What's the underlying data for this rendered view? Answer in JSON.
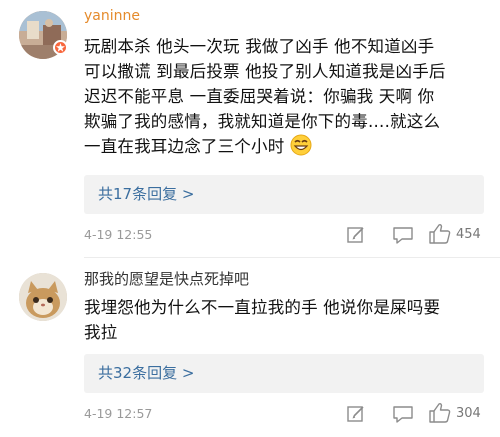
{
  "comments": [
    {
      "username": "yaninne",
      "text_lines": [
        "玩剧本杀 他头一次玩 我做了凶手 他不知道凶手",
        "可以撒谎 到最后投票 他投了别人知道我是凶手后",
        "迟迟不能平息 一直委屈哭着说：你骗我 天啊 你",
        "欺骗了我的感情，我就知道是你下的毒….就这么",
        "一直在我耳边念了三个小时"
      ],
      "emoji": "grinning-emoji",
      "reply_text": "共17条回复 >",
      "date": "4-19",
      "time": "12:55",
      "likes": "454"
    },
    {
      "username": "那我的愿望是快点死掉吧",
      "text_lines": [
        "我埋怨他为什么不一直拉我的手 他说你是屎吗要",
        "我拉"
      ],
      "reply_text": "共32条回复 >",
      "date": "4-19",
      "time": "12:57",
      "likes": "304"
    }
  ],
  "colors": {
    "username_highlight": "#e58b2c",
    "link_blue": "#3b6e9f",
    "reply_bg": "#f2f2f2",
    "meta_gray": "#9a9a9a",
    "badge_red": "#f8673d"
  },
  "icons": [
    "edit-icon",
    "comment-icon",
    "like-icon",
    "verified-badge-icon",
    "grinning-emoji"
  ]
}
